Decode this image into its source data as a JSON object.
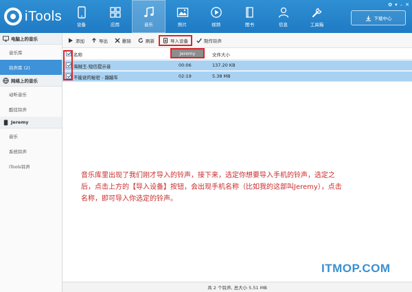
{
  "app": {
    "logo_text": "iTools"
  },
  "nav": [
    {
      "label": "设备",
      "icon": "phone-icon"
    },
    {
      "label": "应用",
      "icon": "apps-grid-icon"
    },
    {
      "label": "音乐",
      "icon": "music-note-icon",
      "active": true
    },
    {
      "label": "照片",
      "icon": "photo-icon"
    },
    {
      "label": "视频",
      "icon": "video-play-icon"
    },
    {
      "label": "图书",
      "icon": "book-icon"
    },
    {
      "label": "信息",
      "icon": "user-icon"
    },
    {
      "label": "工具箱",
      "icon": "wrench-icon"
    }
  ],
  "download_center": {
    "label": "下载中心"
  },
  "sidebar": {
    "sections": [
      {
        "title": "电脑上的音乐",
        "items": [
          {
            "label": "音乐库"
          },
          {
            "label": "铃声库 (2)",
            "active": true
          }
        ]
      },
      {
        "title": "网络上的音乐",
        "items": [
          {
            "label": "动听音乐"
          },
          {
            "label": "酷炫铃声"
          }
        ]
      },
      {
        "title": "Jeremy",
        "items": [
          {
            "label": "音乐"
          },
          {
            "label": "系统铃声"
          },
          {
            "label": "iTools铃声"
          }
        ]
      }
    ]
  },
  "toolbar": {
    "add": "添加",
    "export": "导出",
    "delete": "删除",
    "refresh": "刷新",
    "import_to_device": "导入设备",
    "make_ringtone": "制作铃声"
  },
  "table": {
    "columns": {
      "name": "名称",
      "size": "文件大小"
    },
    "device_popup": "Jeremy",
    "rows": [
      {
        "name": "海贼王-短信提示音",
        "duration": "00:06",
        "size": "137.20 KB"
      },
      {
        "name": "不能说的秘密 - 蹦蹦车",
        "duration": "02:19",
        "size": "5.38 MB"
      }
    ]
  },
  "annotation": {
    "line1": "音乐库里出现了我们刚才导入的铃声，接下来，选定你想要导入手机的铃声，选定之",
    "line2": "后，点击上方的【导入设备】按钮，会出现手机名称（比如我的这部叫Jeremy），点击",
    "line3": "名称，即可导入你选定的铃声。"
  },
  "watermark": "ITMOP.COM",
  "status": "共 2 个铃声, 总大小 5.51 MB",
  "colors": {
    "header_blue": "#1f7bc4",
    "highlight_red": "#d9252a",
    "row_selected": "#a9d2f2",
    "note_red": "#c92a2a"
  }
}
